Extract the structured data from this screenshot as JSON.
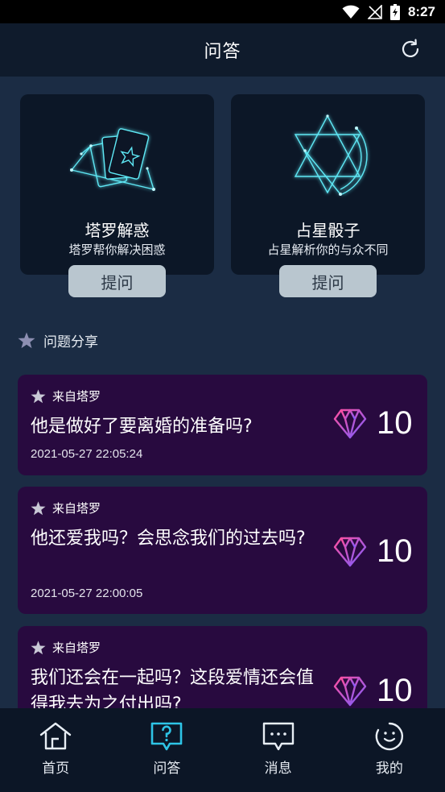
{
  "status_bar": {
    "time": "8:27",
    "icons": [
      "wifi-icon",
      "signal-icon",
      "battery-charging-icon"
    ]
  },
  "header": {
    "title": "问答",
    "refresh_icon": "refresh-icon"
  },
  "features": [
    {
      "title": "塔罗解惑",
      "subtitle": "塔罗帮你解决困惑",
      "button": "提问",
      "icon": "tarot-cards-icon"
    },
    {
      "title": "占星骰子",
      "subtitle": "占星解析你的与众不同",
      "button": "提问",
      "icon": "astro-star-icon"
    }
  ],
  "section": {
    "title": "问题分享",
    "icon": "star-icon"
  },
  "questions": [
    {
      "source": "来自塔罗",
      "text": "他是做好了要离婚的准备吗?",
      "time": "2021-05-27 22:05:24",
      "reward": "10"
    },
    {
      "source": "来自塔罗",
      "text": "他还爱我吗？会思念我们的过去吗?",
      "time": "2021-05-27 22:00:05",
      "reward": "10"
    },
    {
      "source": "来自塔罗",
      "text": "我们还会在一起吗？这段爱情还会值得我去为之付出吗?",
      "time": "",
      "reward": "10"
    }
  ],
  "nav": [
    {
      "label": "首页",
      "icon": "home-icon",
      "active": false
    },
    {
      "label": "问答",
      "icon": "question-bubble-icon",
      "active": true
    },
    {
      "label": "消息",
      "icon": "message-icon",
      "active": false
    },
    {
      "label": "我的",
      "icon": "profile-face-icon",
      "active": false
    }
  ],
  "colors": {
    "accent": "#2ec4e6",
    "card_bg": "#280a3f",
    "page_bg": "#1b2c44",
    "diamond_start": "#ff4fa0",
    "diamond_end": "#7a5cff"
  }
}
